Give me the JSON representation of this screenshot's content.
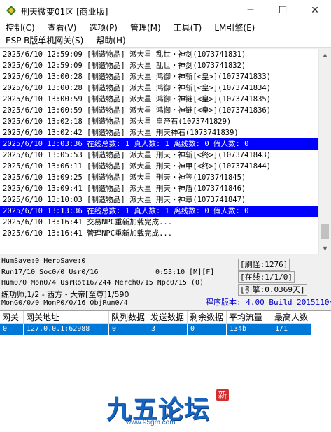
{
  "window": {
    "title": "刑天微变01区 [商业版]",
    "minimize_glyph": "─",
    "maximize_glyph": "☐",
    "close_glyph": "✕"
  },
  "menu": {
    "row1": [
      "控制(C)",
      "查看(V)",
      "选项(P)",
      "管理(M)",
      "工具(T)",
      "LM引擎(E)"
    ],
    "row2": [
      "ESP-B版单机网关(S)",
      "帮助(H)"
    ]
  },
  "log": [
    {
      "text": "2025/6/10 12:59:09 [制造物品] 派大星 乱世・神剑(1073741831)",
      "highlight": false
    },
    {
      "text": "2025/6/10 12:59:09 [制造物品] 派大星 乱世・神剑(1073741832)",
      "highlight": false
    },
    {
      "text": "2025/6/10 13:00:28 [制造物品] 派大星 鸿御・神斩[<皇>](1073741833)",
      "highlight": false
    },
    {
      "text": "2025/6/10 13:00:28 [制造物品] 派大星 鸿御・神斩[<皇>](1073741834)",
      "highlight": false
    },
    {
      "text": "2025/6/10 13:00:59 [制造物品] 派大星 鸿御・神链[<皇>](1073741835)",
      "highlight": false
    },
    {
      "text": "2025/6/10 13:00:59 [制造物品] 派大星 鸿御・神链[<皇>](1073741836)",
      "highlight": false
    },
    {
      "text": "2025/6/10 13:02:18 [制造物品] 派大星 皇帝石(1073741829)",
      "highlight": false
    },
    {
      "text": "2025/6/10 13:02:42 [制造物品] 派大星 刑天神石(1073741839)",
      "highlight": false
    },
    {
      "text": "2025/6/10 13:03:36 在线总数: 1 真人数: 1 离线数: 0 假人数: 0",
      "highlight": true
    },
    {
      "text": "2025/6/10 13:05:53 [制造物品] 派大星 刑天・神斩[<终>](1073741843)",
      "highlight": false
    },
    {
      "text": "2025/6/10 13:06:11 [制造物品] 派大星 刑天・神甲[<终>](1073741844)",
      "highlight": false
    },
    {
      "text": "2025/6/10 13:09:25 [制造物品] 派大星 刑天・神笠(1073741845)",
      "highlight": false
    },
    {
      "text": "2025/6/10 13:09:41 [制造物品] 派大星 刑天・神盾(1073741846)",
      "highlight": false
    },
    {
      "text": "2025/6/10 13:10:03 [制造物品] 派大星 刑天・神章(1073741847)",
      "highlight": false
    },
    {
      "text": "2025/6/10 13:13:36 在线总数: 1 真人数: 1 离线数: 0 假人数: 0",
      "highlight": true
    },
    {
      "text": "2025/6/10 13:16:41 交易NPC重新加载完成...",
      "highlight": false
    },
    {
      "text": "2025/6/10 13:16:41 管理NPC重新加载完成...",
      "highlight": false
    }
  ],
  "status": {
    "line1": "HumSave:0 HeroSave:0",
    "line2a": "Run17/10 Soc0/0 Usr0/16",
    "line2b": "0:53:10 [M][F]",
    "line3": "Hum0/0 Mon0/4 UsrRot16/244 Merch0/15 Npc0/15 (0)",
    "line4": "练功师,1/2 - 西方・大帝[至尊]1/590",
    "line5": "MonG0/0/0 MonP0/0/16 ObjRun0/4",
    "refresh": "[刷怪:1276]",
    "online": "[在线:1/1/0]",
    "engine": "[引擎:0.0369天]",
    "version": "程序版本: 4.00 Build 20151104"
  },
  "table": {
    "headers": [
      "网关",
      "网关地址",
      "队列数据",
      "发送数据",
      "剩余数据",
      "平均流量",
      "最高人数"
    ],
    "rows": [
      [
        "0",
        "127.0.0.1:62988",
        "0",
        "3",
        "0",
        "134b",
        "1/1"
      ]
    ]
  },
  "logo": {
    "text": "九五论坛",
    "url": "www.95gm.com",
    "seal": "新"
  }
}
